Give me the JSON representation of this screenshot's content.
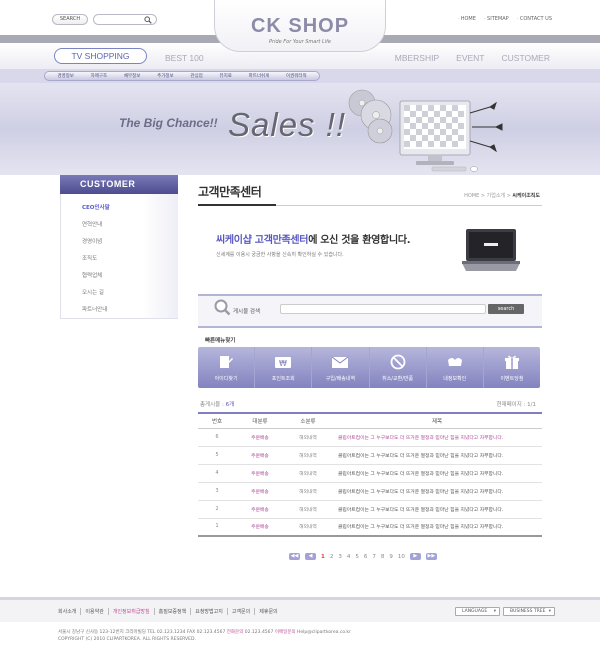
{
  "header": {
    "search_label": "SEARCH",
    "links": [
      "HOME",
      "SITEMAP",
      "CONTACT US"
    ],
    "logo": "CK SHOP",
    "tagline": "Pride For Your Smart Life"
  },
  "nav": {
    "tv": "TV SHOPPING",
    "best": "BEST 100",
    "right": [
      "MBERSHIP",
      "EVENT",
      "CUSTOMER"
    ]
  },
  "subnav": [
    "경영정보",
    "자매구조",
    "채무정보",
    "추가정보",
    "관심업",
    "뮤지료",
    "파트너쉬게",
    "이권워터워"
  ],
  "banner": {
    "big": "The Big Chance!!",
    "sales": "Sales !!"
  },
  "sidebar": {
    "title": "CUSTOMER",
    "items": [
      "CEO인사말",
      "연혁안내",
      "경영이념",
      "조직도",
      "협력업체",
      "오시는 길",
      "파트너안내"
    ]
  },
  "content": {
    "title": "고객만족센터",
    "breadcrumb_path": "HOME > 기업소개 > ",
    "breadcrumb_current": "씨케이조직도",
    "welcome_hl1": "씨케이샵",
    "welcome_hl2": "고객만족센터",
    "welcome_rest": "에 오신 것을 환영합니다.",
    "welcome_sub": "신세계를 이용시 궁금한 사항을 신속히 확인하실 수 있습니다."
  },
  "search_panel": {
    "label": "게시물 검색",
    "button": "search"
  },
  "quick": {
    "title": "빠른메뉴찾기",
    "items": [
      "아이디찾기",
      "포인트조회",
      "구입/배송내역",
      "취소/교환/반품",
      "내정보확인",
      "이벤트당첨"
    ]
  },
  "board": {
    "count_label": "총게시물 : ",
    "count": "6개",
    "page_info": "현재페이지 : 1/1",
    "headers": [
      "번호",
      "대분류",
      "소분류",
      "제목"
    ],
    "rows": [
      {
        "no": "6",
        "cat": "주문배송",
        "sub": "해외내역",
        "subject": "클립아트컵이는 그 누구보다도 더 뜨거운 열정과 믿마난 힘을 지녔다고 자부합니다."
      },
      {
        "no": "5",
        "cat": "주문배송",
        "sub": "해외내역",
        "subject": "클립아트컵이는 그 누구보다도 더 뜨거운 열정과 믿마난 힘을 지녔다고 자부합니다."
      },
      {
        "no": "4",
        "cat": "주문배송",
        "sub": "해외내역",
        "subject": "클립아트컵이는 그 누구보다도 더 뜨거운 열정과 믿마난 힘을 지녔다고 자부합니다."
      },
      {
        "no": "3",
        "cat": "주문배송",
        "sub": "해외내역",
        "subject": "클립아트컵이는 그 누구보다도 더 뜨거운 열정과 믿마난 힘을 지녔다고 자부합니다."
      },
      {
        "no": "2",
        "cat": "주문배송",
        "sub": "해외내역",
        "subject": "클립아트컵이는 그 누구보다도 더 뜨거운 열정과 믿마난 힘을 지녔다고 자부합니다."
      },
      {
        "no": "1",
        "cat": "주문배송",
        "sub": "해외내역",
        "subject": "클립아트컵이는 그 누구보다도 더 뜨거운 열정과 믿마난 힘을 지녔다고 자부합니다."
      }
    ]
  },
  "pagination": {
    "prev2": "◀◀",
    "prev": "◀",
    "pages": [
      "1",
      "2",
      "3",
      "4",
      "5",
      "6",
      "7",
      "8",
      "9",
      "10"
    ],
    "next": "▶",
    "next2": "▶▶"
  },
  "footer": {
    "links": [
      "회사소개",
      "이용약관",
      "개인정보취급방침",
      "홈질보증정책",
      "요청방법고지",
      "고객문의",
      "제휴문의"
    ],
    "language": "LANGUAGE",
    "business": "BUSINESS TREE",
    "addr1": "서울시 강남구 신사동 123-12번지 크리마빌딩  TEL 02.123.1234  FAX 02.123.4567",
    "addr1_label": "전화문의",
    "addr1_tel": "02.123.4567",
    "addr1_label2": "이메일문의",
    "addr1_mail": "Help@clipartkorea.co.kr",
    "addr2": "COPYRIGHT (C) 2010 CLIPARTKOREA. ALL RIGHTS RESERVED."
  }
}
